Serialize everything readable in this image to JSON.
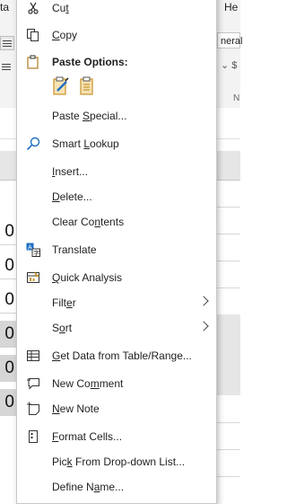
{
  "background": {
    "ribbon_left_text": "ta",
    "ribbon_right_text": "He",
    "combo_text": "neral",
    "small_text": "⌄ $",
    "group_letter": "N",
    "cell_values": [
      "0",
      "0",
      "0",
      "0",
      "0",
      "0"
    ]
  },
  "menu": {
    "cut": {
      "pre": "Cu",
      "key": "t",
      "post": ""
    },
    "copy": {
      "pre": "",
      "key": "C",
      "post": "opy"
    },
    "paste_options": "Paste Options:",
    "paste_special": {
      "pre": "Paste ",
      "key": "S",
      "post": "pecial..."
    },
    "smart_lookup": {
      "pre": "Smart ",
      "key": "L",
      "post": "ookup"
    },
    "insert": {
      "pre": "",
      "key": "I",
      "post": "nsert..."
    },
    "delete": {
      "pre": "",
      "key": "D",
      "post": "elete..."
    },
    "clear_contents": {
      "pre": "Clear Co",
      "key": "n",
      "post": "tents"
    },
    "translate": "Translate",
    "quick_analysis": {
      "pre": "",
      "key": "Q",
      "post": "uick Analysis"
    },
    "filter": {
      "pre": "Filt",
      "key": "e",
      "post": "r"
    },
    "sort": {
      "pre": "S",
      "key": "o",
      "post": "rt"
    },
    "get_data": {
      "pre": "",
      "key": "G",
      "post": "et Data from Table/Range..."
    },
    "new_comment": {
      "pre": "New Co",
      "key": "m",
      "post": "ment"
    },
    "new_note": {
      "pre": "",
      "key": "N",
      "post": "ew Note"
    },
    "format_cells": {
      "pre": "",
      "key": "F",
      "post": "ormat Cells..."
    },
    "pick_list": {
      "pre": "Pic",
      "key": "k",
      "post": " From Drop-down List..."
    },
    "define_name": {
      "pre": "Define N",
      "key": "a",
      "post": "me..."
    }
  },
  "colors": {
    "accent": "#2b579a",
    "gold": "#c8932a",
    "blue_icon": "#1e6fc4"
  }
}
